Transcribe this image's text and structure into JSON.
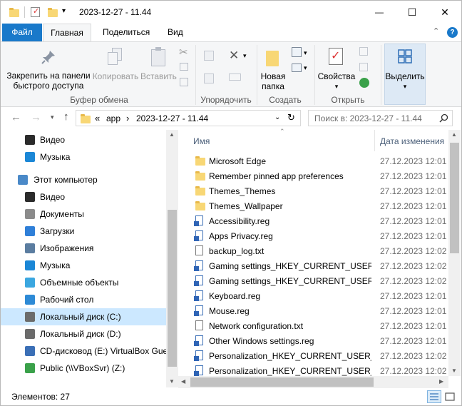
{
  "window": {
    "title": "2023-12-27 - 11.44",
    "min_glyph": "—",
    "max_glyph": "☐",
    "close_glyph": "✕"
  },
  "tabs": {
    "file": "Файл",
    "home": "Главная",
    "share": "Поделиться",
    "view": "Вид"
  },
  "ribbon": {
    "pin_label_1": "Закрепить на панели",
    "pin_label_2": "быстрого доступа",
    "copy_label": "Копировать",
    "paste_label": "Вставить",
    "clipboard_group": "Буфер обмена",
    "organize_group": "Упорядочить",
    "new_folder_1": "Новая",
    "new_folder_2": "папка",
    "create_group": "Создать",
    "properties_label": "Свойства",
    "open_group": "Открыть",
    "select_label": "Выделить"
  },
  "address": {
    "prefix": "«",
    "crumb_1": "app",
    "sep": "›",
    "crumb_2": "2023-12-27 - 11.44",
    "search_placeholder": "Поиск в: 2023-12-27 - 11.44"
  },
  "nav": {
    "items": [
      {
        "label": "Видео",
        "icon": "video-icon",
        "indent": 1
      },
      {
        "label": "Музыка",
        "icon": "music-icon",
        "indent": 1
      },
      {
        "label": "Этот компьютер",
        "icon": "computer-icon",
        "indent": 0
      },
      {
        "label": "Видео",
        "icon": "video-icon",
        "indent": 1
      },
      {
        "label": "Документы",
        "icon": "documents-icon",
        "indent": 1
      },
      {
        "label": "Загрузки",
        "icon": "downloads-icon",
        "indent": 1
      },
      {
        "label": "Изображения",
        "icon": "pictures-icon",
        "indent": 1
      },
      {
        "label": "Музыка",
        "icon": "music-icon",
        "indent": 1
      },
      {
        "label": "Объемные объекты",
        "icon": "3d-objects-icon",
        "indent": 1
      },
      {
        "label": "Рабочий стол",
        "icon": "desktop-icon",
        "indent": 1
      },
      {
        "label": "Локальный диск (C:)",
        "icon": "drive-c-icon",
        "indent": 1,
        "selected": true
      },
      {
        "label": "Локальный диск (D:)",
        "icon": "drive-icon",
        "indent": 1
      },
      {
        "label": "CD-дисковод (E:) VirtualBox Gues",
        "icon": "cd-drive-icon",
        "indent": 1
      },
      {
        "label": "Public (\\\\VBoxSvr) (Z:)",
        "icon": "network-drive-icon",
        "indent": 1
      }
    ]
  },
  "columns": {
    "name": "Имя",
    "date": "Дата изменения"
  },
  "files": [
    {
      "name": "Microsoft Edge",
      "date": "27.12.2023 12:01",
      "type": "folder"
    },
    {
      "name": "Remember pinned app preferences",
      "date": "27.12.2023 12:01",
      "type": "folder"
    },
    {
      "name": "Themes_Themes",
      "date": "27.12.2023 12:01",
      "type": "folder"
    },
    {
      "name": "Themes_Wallpaper",
      "date": "27.12.2023 12:01",
      "type": "folder"
    },
    {
      "name": "Accessibility.reg",
      "date": "27.12.2023 12:01",
      "type": "reg"
    },
    {
      "name": "Apps Privacy.reg",
      "date": "27.12.2023 12:01",
      "type": "reg"
    },
    {
      "name": "backup_log.txt",
      "date": "27.12.2023 12:02",
      "type": "txt"
    },
    {
      "name": "Gaming settings_HKEY_CURRENT_USER_...",
      "date": "27.12.2023 12:02",
      "type": "reg"
    },
    {
      "name": "Gaming settings_HKEY_CURRENT_USER_...",
      "date": "27.12.2023 12:02",
      "type": "reg"
    },
    {
      "name": "Keyboard.reg",
      "date": "27.12.2023 12:01",
      "type": "reg"
    },
    {
      "name": "Mouse.reg",
      "date": "27.12.2023 12:01",
      "type": "reg"
    },
    {
      "name": "Network configuration.txt",
      "date": "27.12.2023 12:01",
      "type": "txt"
    },
    {
      "name": "Other Windows settings.reg",
      "date": "27.12.2023 12:01",
      "type": "reg"
    },
    {
      "name": "Personalization_HKEY_CURRENT_USER_S...",
      "date": "27.12.2023 12:02",
      "type": "reg"
    },
    {
      "name": "Personalization_HKEY_CURRENT_USER_S...",
      "date": "27.12.2023 12:02",
      "type": "reg"
    }
  ],
  "status": {
    "count": "Элементов: 27"
  },
  "colors": {
    "accent": "#1979ca",
    "selection": "#cce8ff",
    "folder": "#f8d775"
  }
}
